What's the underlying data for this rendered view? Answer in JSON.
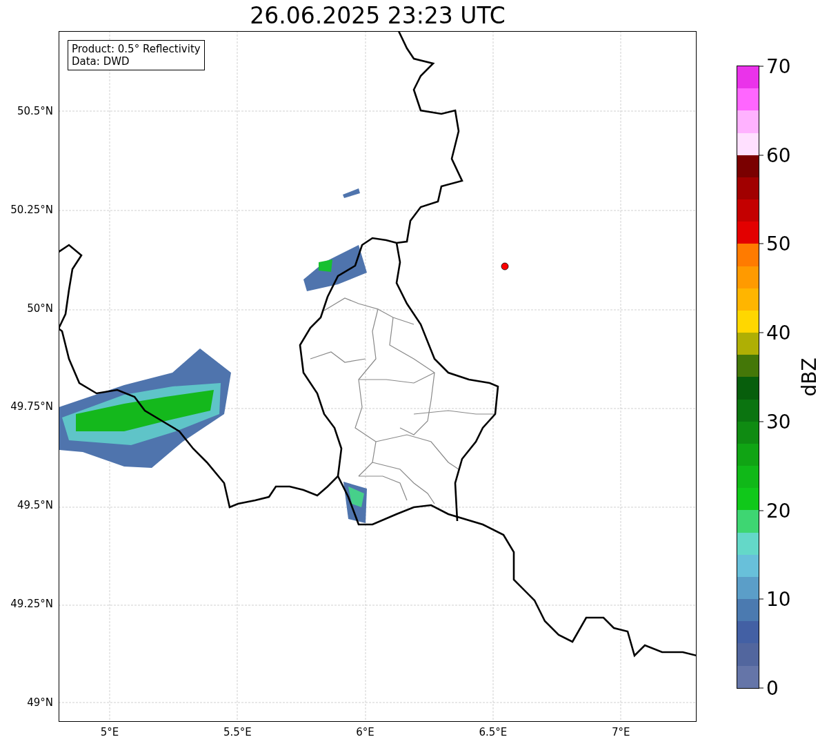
{
  "title": "26.06.2025 23:23 UTC",
  "info_box": {
    "lines": [
      "Product: 0.5° Reflectivity",
      "Data: DWD"
    ]
  },
  "map": {
    "lat_labels": [
      "50.5°N",
      "50.25°N",
      "50°N",
      "49.75°N",
      "49.5°N",
      "49.25°N",
      "49°N"
    ],
    "lon_labels": [
      "5°E",
      "5.5°E",
      "6°E",
      "6.5°E",
      "7°E"
    ]
  },
  "colorbar": {
    "label": "dBZ",
    "tick_labels": [
      "70",
      "60",
      "50",
      "40",
      "30",
      "20",
      "10",
      "0"
    ],
    "bins": [
      {
        "color": "#ea33ea"
      },
      {
        "color": "#ff66ff"
      },
      {
        "color": "#ffb2ff"
      },
      {
        "color": "#ffe0ff"
      },
      {
        "color": "#7a0000"
      },
      {
        "color": "#a10000"
      },
      {
        "color": "#c40000"
      },
      {
        "color": "#e30000"
      },
      {
        "color": "#ff7b00"
      },
      {
        "color": "#ff9a00"
      },
      {
        "color": "#ffb500"
      },
      {
        "color": "#ffd700"
      },
      {
        "color": "#afaf04"
      },
      {
        "color": "#447708"
      },
      {
        "color": "#075e0c"
      },
      {
        "color": "#0b7410"
      },
      {
        "color": "#0f8b12"
      },
      {
        "color": "#10a414"
      },
      {
        "color": "#10b818"
      },
      {
        "color": "#10c81a"
      },
      {
        "color": "#3ed672"
      },
      {
        "color": "#64d8c8"
      },
      {
        "color": "#68c0da"
      },
      {
        "color": "#5b9ec8"
      },
      {
        "color": "#4b7ab0"
      },
      {
        "color": "#4360a4"
      },
      {
        "color": "#52669e"
      },
      {
        "color": "#6575a8"
      }
    ]
  }
}
